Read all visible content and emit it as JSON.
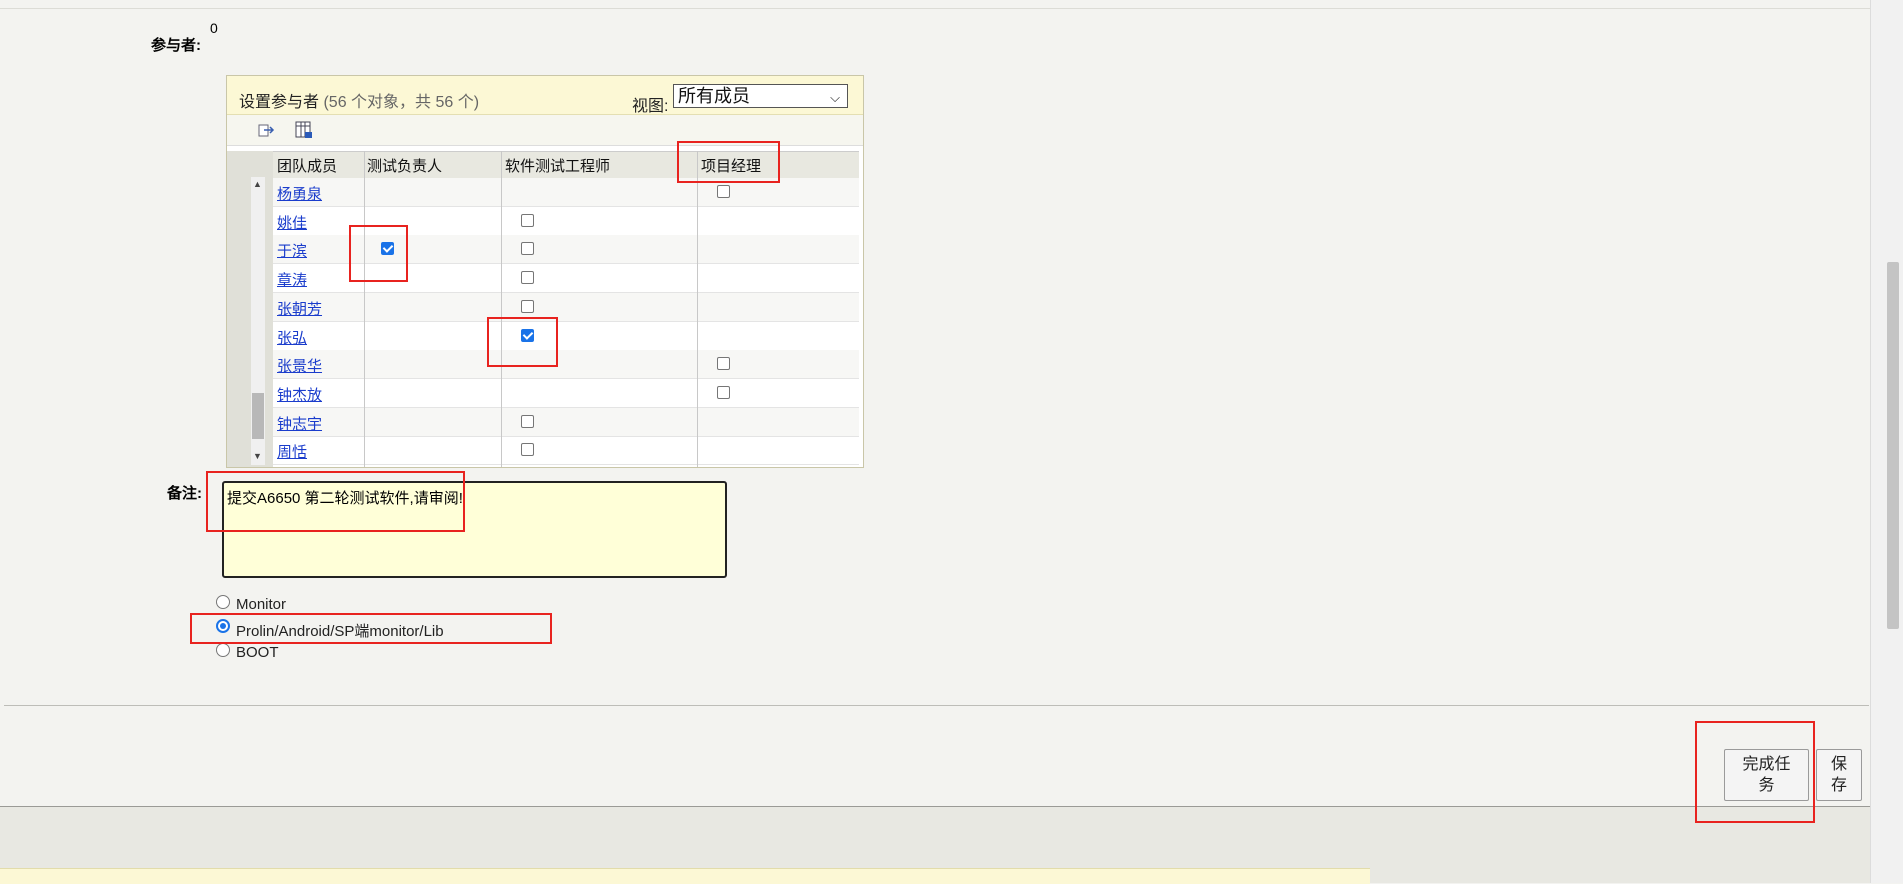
{
  "participants": {
    "label": "参与者:",
    "count": "0"
  },
  "panel": {
    "title": "设置参与者",
    "count_text": "(56 个对象，共 56 个)",
    "view_label": "视图:",
    "view_value": "所有成员"
  },
  "table": {
    "headers": [
      "团队成员",
      "测试负责人",
      "软件测试工程师",
      "项目经理"
    ],
    "rows": [
      {
        "name": "杨勇泉",
        "test_lead": null,
        "engineer": null,
        "pm": false
      },
      {
        "name": "姚佳",
        "test_lead": null,
        "engineer": false,
        "pm": null
      },
      {
        "name": "于滨",
        "test_lead": true,
        "engineer": false,
        "pm": null
      },
      {
        "name": "章涛",
        "test_lead": null,
        "engineer": false,
        "pm": null
      },
      {
        "name": "张朝芳",
        "test_lead": null,
        "engineer": false,
        "pm": null
      },
      {
        "name": "张弘",
        "test_lead": null,
        "engineer": true,
        "pm": null
      },
      {
        "name": "张景华",
        "test_lead": null,
        "engineer": null,
        "pm": false
      },
      {
        "name": "钟杰放",
        "test_lead": null,
        "engineer": null,
        "pm": false
      },
      {
        "name": "钟志宇",
        "test_lead": null,
        "engineer": false,
        "pm": null
      },
      {
        "name": "周恬",
        "test_lead": null,
        "engineer": false,
        "pm": null
      }
    ]
  },
  "notes": {
    "label": "备注:",
    "value": "提交A6650 第二轮测试软件,请审阅!"
  },
  "options": [
    {
      "label": "Monitor",
      "selected": false
    },
    {
      "label": "Prolin/Android/SP端monitor/Lib",
      "selected": true
    },
    {
      "label": "BOOT",
      "selected": false
    }
  ],
  "buttons": {
    "complete": "完成任务",
    "save": "保存"
  },
  "colors": {
    "link": "#1a3ccc",
    "panel_header": "#fcf8d5",
    "notes_bg": "#ffffd8",
    "annotation": "#e8231f",
    "checkbox_on": "#1a73e8"
  }
}
